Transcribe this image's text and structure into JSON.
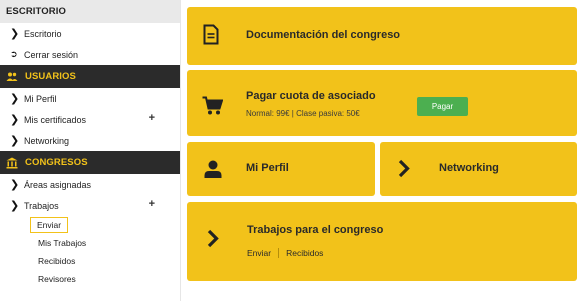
{
  "sidebar": {
    "escritorio": {
      "title": "ESCRITORIO",
      "items": [
        {
          "label": "Escritorio"
        },
        {
          "label": "Cerrar sesión"
        }
      ]
    },
    "usuarios": {
      "title": "USUARIOS",
      "items": [
        {
          "label": "Mi Perfil"
        },
        {
          "label": "Mis certificados",
          "plus": "+"
        },
        {
          "label": "Networking"
        }
      ]
    },
    "congresos": {
      "title": "CONGRESOS",
      "items": [
        {
          "label": "Áreas asignadas"
        },
        {
          "label": "Trabajos",
          "plus": "+"
        }
      ],
      "subitems": [
        {
          "label": "Enviar"
        },
        {
          "label": "Mis Trabajos"
        },
        {
          "label": "Recibidos"
        },
        {
          "label": "Revisores"
        }
      ]
    }
  },
  "cards": {
    "documentacion": {
      "title": "Documentación del congreso"
    },
    "pagar": {
      "title": "Pagar cuota de asociado",
      "subtitle": "Normal: 99€ | Clase pasiva: 50€",
      "button": "Pagar"
    },
    "perfil": {
      "title": "Mi Perfil"
    },
    "networking": {
      "title": "Networking"
    },
    "trabajos": {
      "title": "Trabajos para el congreso",
      "link1": "Enviar",
      "link2": "Recibidos"
    }
  },
  "colors": {
    "accent": "#f2c21a",
    "dark": "#2b2b2b",
    "button": "#4caf50"
  }
}
